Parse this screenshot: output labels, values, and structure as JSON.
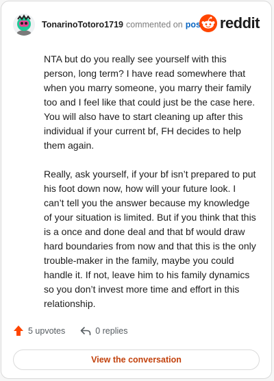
{
  "header": {
    "username": "TonarinoTotoro1719",
    "action_text": "commented on",
    "post_link": "post",
    "brand": "reddit"
  },
  "comment": {
    "paragraphs": [
      "NTA but do you really see yourself with this person, long term? I have read somewhere that when you marry someone, you marry their family too and I feel like that could just be the case here. You will also have to start cleaning up after this individual if your current bf, FH decides to help them again.",
      "Really, ask yourself, if your bf isn’t prepared to put his foot down now, how will your future look. I can’t tell you the answer because my knowledge of your situation is limited. But if you think that this is a once and done deal and that bf would draw hard boundaries from now and that this is the only trouble-maker in the family, maybe you could handle it. If not, leave him to his family dynamics so you don’t invest more time and effort in this relationship."
    ]
  },
  "actions": {
    "upvotes": "5 upvotes",
    "replies": "0 replies",
    "upvote_icon": "upvote-arrow-icon",
    "reply_icon": "reply-arrow-icon"
  },
  "cta": {
    "label": "View the conversation"
  },
  "colors": {
    "accent": "#ff4500",
    "link": "#0a66c2",
    "cta_text": "#c2410c"
  }
}
